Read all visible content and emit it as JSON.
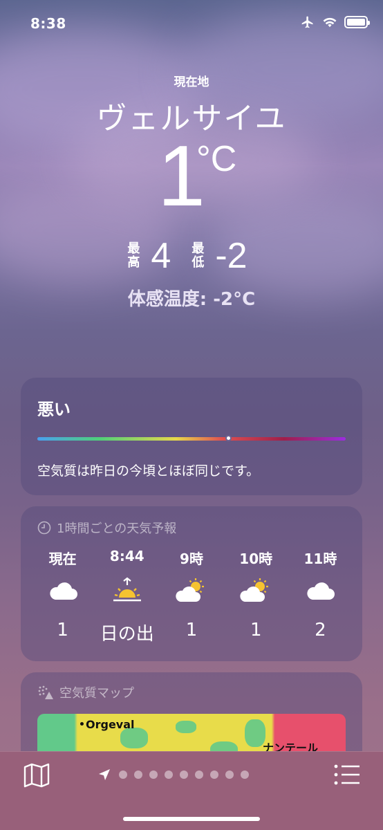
{
  "status": {
    "time": "8:38",
    "icons": [
      "airplane-icon",
      "wifi-icon",
      "battery-icon"
    ]
  },
  "header": {
    "location_label": "現在地",
    "city": "ヴェルサイユ",
    "temperature": "1",
    "unit": "°C",
    "high_label": "最高",
    "high": "4",
    "low_label": "最低",
    "low": "-2",
    "feels_like": "体感温度: -2°C"
  },
  "air_quality": {
    "title": "悪い",
    "description": "空気質は昨日の今頃とほぼ同じです。",
    "indicator_position": 0.62
  },
  "hourly": {
    "header": "1時間ごとの天気予報",
    "items": [
      {
        "time": "現在",
        "icon": "cloud-icon",
        "value": "1"
      },
      {
        "time": "8:44",
        "icon": "sunrise-icon",
        "value": "日の出"
      },
      {
        "time": "9時",
        "icon": "partly-cloudy-icon",
        "value": "1"
      },
      {
        "time": "10時",
        "icon": "partly-cloudy-icon",
        "value": "1"
      },
      {
        "time": "11時",
        "icon": "cloud-icon",
        "value": "2"
      }
    ]
  },
  "aq_map": {
    "header": "空気質マップ",
    "labels": [
      "Orgeval",
      "ナンテール"
    ]
  },
  "tabbar": {
    "page_count": 9,
    "colors": {
      "background": "#98607a"
    }
  }
}
